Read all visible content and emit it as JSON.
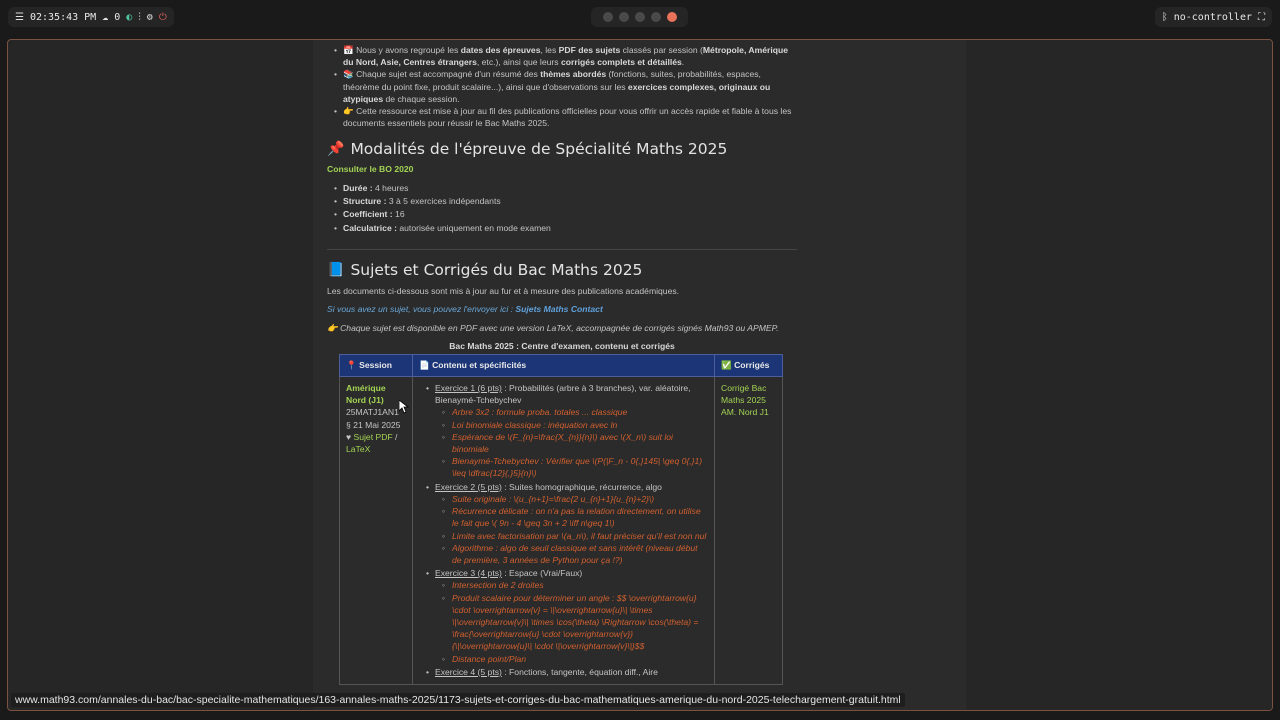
{
  "topbar": {
    "time": "02:35:43 PM",
    "cloud_count": "0",
    "controller_label": "no-controller"
  },
  "intro_bullets": [
    {
      "pre": "📅 Nous y avons regroupé les ",
      "b1": "dates des épreuves",
      "m1": ", les ",
      "b2": "PDF des sujets",
      "m2": " classés par session (",
      "b3": "Métropole, Amérique du Nord, Asie, Centres étrangers",
      "m3": ", etc.), ainsi que leurs ",
      "b4": "corrigés complets et détaillés",
      "post": "."
    },
    {
      "pre": "📚 Chaque sujet est accompagné d'un résumé des ",
      "b1": "thèmes abordés",
      "m1": " (fonctions, suites, probabilités, espaces, théorème du point fixe, produit scalaire...), ainsi que d'observations sur les ",
      "b2": "exercices complexes, originaux ou atypiques",
      "post": " de chaque session."
    },
    {
      "text": "👉 Cette ressource est mise à jour au fil des publications officielles pour vous offrir un accès rapide et fiable à tous les documents essentiels pour réussir le Bac Maths 2025."
    }
  ],
  "modalites": {
    "emoji": "📌",
    "title": "Modalités de l'épreuve de Spécialité Maths 2025",
    "bo_link": "Consulter le BO 2020",
    "items": [
      {
        "label": "Durée :",
        "value": " 4 heures"
      },
      {
        "label": "Structure :",
        "value": " 3 à 5 exercices indépendants"
      },
      {
        "label": "Coefficient :",
        "value": " 16"
      },
      {
        "label": "Calculatrice :",
        "value": " autorisée uniquement en mode examen"
      }
    ]
  },
  "sujets": {
    "emoji": "📘",
    "title": "Sujets et Corrigés du Bac Maths 2025",
    "intro": "Les documents ci-dessous sont mis à jour au fur et à mesure des publications académiques.",
    "send_text": "Si vous avez un sujet, vous pouvez l'envoyer ici : ",
    "send_link": "Sujets Maths Contact",
    "note": "👉 Chaque sujet est disponible en PDF avec une version LaTeX, accompagnée de corrigés signés Math93 ou APMEP.",
    "caption": "Bac Maths 2025 : Centre d'examen, contenu et corrigés"
  },
  "table": {
    "headers": [
      "📍 Session",
      "📄 Contenu et spécificités",
      "✅ Corrigés"
    ],
    "session": {
      "name": "Amérique Nord (J1)",
      "code": "25MATJ1AN1",
      "date": "§ 21 Mai 2025",
      "pdf_prefix": "♥ ",
      "pdf_link": "Sujet PDF",
      "sep": " / ",
      "latex_link": "LaTeX"
    },
    "corrige_link": "Corrigé Bac Maths 2025 AM. Nord J1",
    "exercises": [
      {
        "title": "Exercice 1 (6 pts)",
        "desc": " : Probabilités (arbre à 3 branches), var. aléatoire, Bienaymé-Tchebychev",
        "notes": [
          "Arbre 3x2 : formule proba. totales ... classique",
          "Loi binomiale classique : inéquation avec ln",
          "Espérance de \\(F_{n}=\\frac{X_{n}}{n}\\) avec \\(X_n\\) suit loi binomiale",
          "Bienaymé-Tchebychev : Vérifier que \\(P(|F_n - 0{,}145| \\geq 0{,}1) \\leq \\dfrac{12}{,}5}{n}\\)"
        ]
      },
      {
        "title": "Exercice 2 (5 pts)",
        "desc": " : Suites homographique, récurrence, algo",
        "notes": [
          "Suite originale : \\(u_{n+1}=\\frac{2 u_{n}+1}{u_{n}+2}\\)",
          "Récurrence délicate : on n'a pas la relation directement, on utilise le fait que \\( 9n - 4 \\geq 3n + 2 \\iff n\\geq 1\\)",
          "Limite avec factorisation par \\(a_n\\), il faut préciser qu'il est non nul",
          "Algorithme : algo de seuil classique et sans intérêt (niveau début de première, 3 années de Python pour ça !?)"
        ]
      },
      {
        "title": "Exercice 3 (4 pts)",
        "desc": " : Espace (Vrai/Faux)",
        "notes": [
          "Intersection de 2 droites",
          "Produit scalaire pour déterminer un angle :  $$ \\overrightarrow{u} \\cdot \\overrightarrow{v} = \\|\\overrightarrow{u}\\| \\times \\|\\overrightarrow{v}\\| \\times \\cos(\\theta) \\Rightarrow \\cos(\\theta) = \\frac{\\overrightarrow{u} \\cdot \\overrightarrow{v}}{\\|\\overrightarrow{u}\\| \\cdot \\|\\overrightarrow{v}\\|}$$",
          "Distance point/Plan"
        ]
      },
      {
        "title": "Exercice 4 (5 pts)",
        "desc": " : Fonctions, tangente, équation diff., Aire",
        "notes": []
      }
    ]
  },
  "status_url": "www.math93.com/annales-du-bac/bac-specialite-mathematiques/163-annales-maths-2025/1173-sujets-et-corriges-du-bac-mathematiques-amerique-du-nord-2025-telechargement-gratuit.html",
  "colors": {
    "accent": "#a3d354",
    "table_header": "#1b3577",
    "note_orange": "#d2602f",
    "link_blue": "#6aa7d8"
  }
}
